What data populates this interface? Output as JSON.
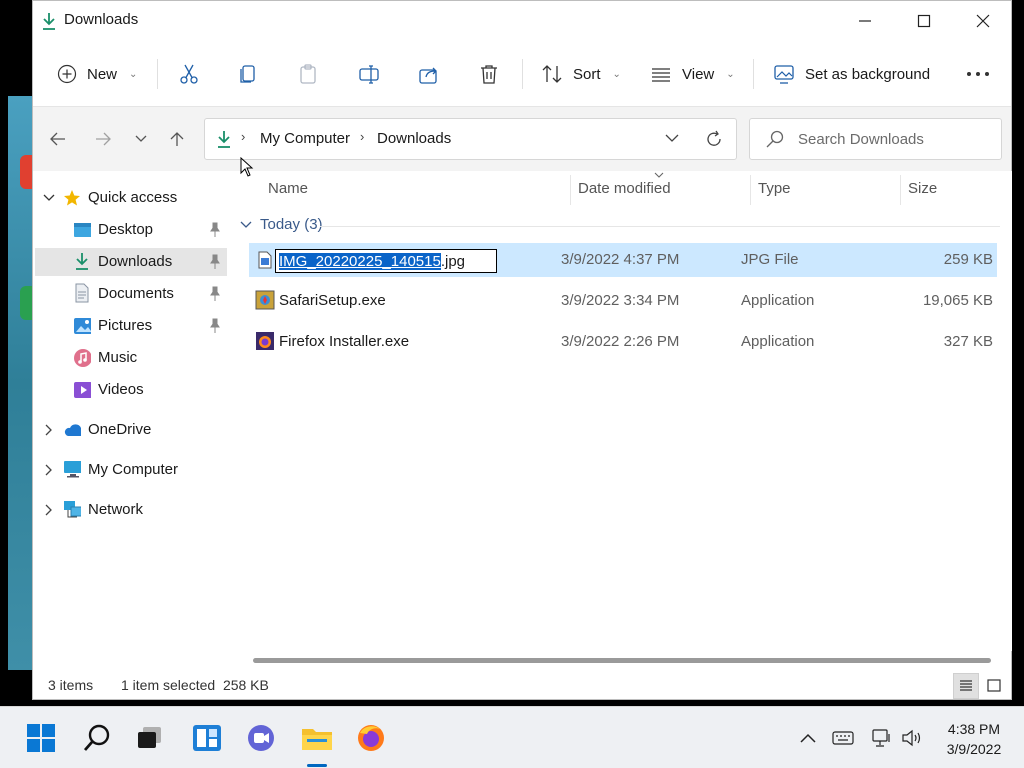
{
  "window": {
    "title": "Downloads"
  },
  "toolbar": {
    "new_label": "New",
    "sort_label": "Sort",
    "view_label": "View",
    "set_background_label": "Set as background"
  },
  "address": {
    "segments": [
      "My Computer",
      "Downloads"
    ]
  },
  "search": {
    "placeholder": "Search Downloads"
  },
  "sidebar": {
    "quick_access": "Quick access",
    "items": [
      {
        "label": "Desktop",
        "icon": "desktop-icon",
        "pinned": true
      },
      {
        "label": "Downloads",
        "icon": "download-icon",
        "pinned": true,
        "selected": true
      },
      {
        "label": "Documents",
        "icon": "document-icon",
        "pinned": true
      },
      {
        "label": "Pictures",
        "icon": "picture-icon",
        "pinned": true
      },
      {
        "label": "Music",
        "icon": "music-icon",
        "pinned": false
      },
      {
        "label": "Videos",
        "icon": "video-icon",
        "pinned": false
      }
    ],
    "onedrive": "OneDrive",
    "my_computer": "My Computer",
    "network": "Network"
  },
  "columns": {
    "name": "Name",
    "date_modified": "Date modified",
    "type": "Type",
    "size": "Size"
  },
  "group": {
    "label": "Today (3)"
  },
  "files": [
    {
      "name_selected": "IMG_20220225_140515",
      "name_ext": ".jpg",
      "date": "3/9/2022 4:37 PM",
      "type": "JPG File",
      "size": "259 KB",
      "selected": true,
      "renaming": true,
      "icon": "image-file-icon"
    },
    {
      "name": "SafariSetup.exe",
      "date": "3/9/2022 3:34 PM",
      "type": "Application",
      "size": "19,065 KB",
      "icon": "safari-setup-icon"
    },
    {
      "name": "Firefox Installer.exe",
      "date": "3/9/2022 2:26 PM",
      "type": "Application",
      "size": "327 KB",
      "icon": "firefox-installer-icon"
    }
  ],
  "status": {
    "items": "3 items",
    "selection": "1 item selected  258 KB"
  },
  "clock": {
    "time": "4:38 PM",
    "date": "3/9/2022"
  },
  "colors": {
    "accent": "#0067c0",
    "selection": "#cce8ff",
    "sidebar_selected": "#e5e5e5"
  }
}
